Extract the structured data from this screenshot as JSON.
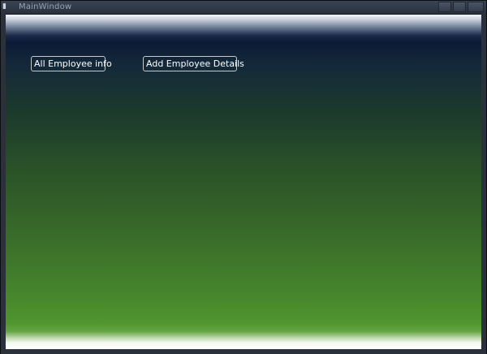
{
  "window": {
    "title": "MainWindow"
  },
  "buttons": {
    "all_employee_info": "All Employee info",
    "add_employee_details": "Add Employee Details"
  },
  "icons": {
    "system_menu": "window-icon",
    "minimize": "minimize-icon",
    "maximize": "maximize-icon",
    "close": "close-icon"
  },
  "colors": {
    "gradient_top": "#0b1a36",
    "gradient_bottom": "#50962e",
    "button_text": "#ffffff",
    "button_border": "#c8c8c8"
  }
}
